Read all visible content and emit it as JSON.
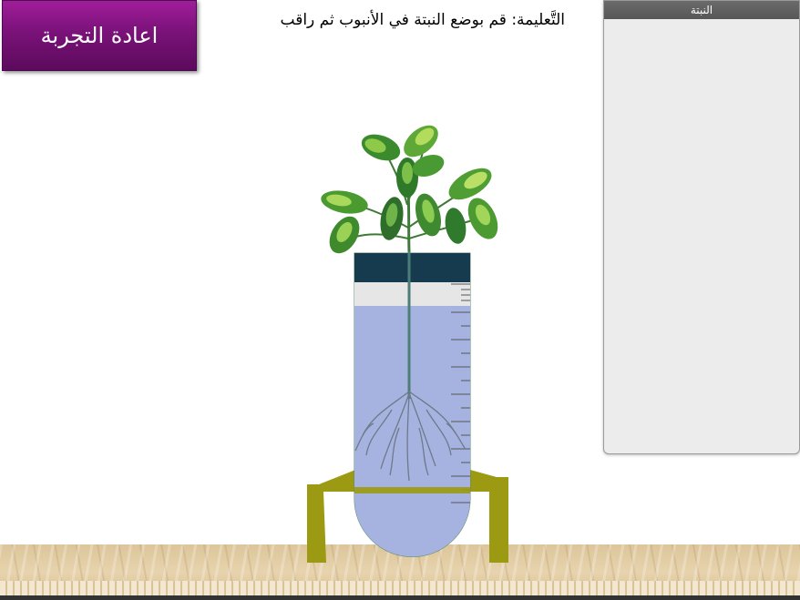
{
  "toolbar": {
    "retry_label": "اعادة التجربة"
  },
  "instruction_text": "التَّعليمة: قم بوضع النبتة في الأنبوب ثم راقب",
  "panel": {
    "title": "النبتة"
  },
  "colors": {
    "button_purple": "#7a1279",
    "water": "#a6b3e0",
    "stand": "#9c9a12",
    "tube_cap": "#163a4e"
  }
}
